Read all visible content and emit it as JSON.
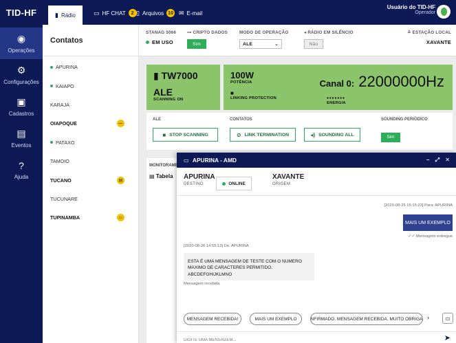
{
  "app": {
    "title": "TID-HF"
  },
  "nav": [
    {
      "label": "Operações",
      "icon": "radio-icon"
    },
    {
      "label": "Configurações",
      "icon": "gear-icon"
    },
    {
      "label": "Cadastros",
      "icon": "document-icon"
    },
    {
      "label": "Eventos",
      "icon": "calendar-icon"
    },
    {
      "label": "Ajuda",
      "icon": "help-icon"
    }
  ],
  "tabs": [
    {
      "label": "Rádio",
      "icon": "radio-icon"
    },
    {
      "label": "HF CHAT",
      "icon": "chat-icon",
      "badge": "2"
    },
    {
      "label": "Arquivos",
      "icon": "file-icon",
      "badge": "10"
    },
    {
      "label": "E-mail",
      "icon": "mail-icon"
    }
  ],
  "user": {
    "name": "Usuário do TID-HF",
    "role": "Operador"
  },
  "contacts": {
    "title": "Contatos",
    "items": [
      {
        "name": "APURINA",
        "online": true,
        "bold": false,
        "badge": ""
      },
      {
        "name": "KAIAPO",
        "online": true,
        "bold": false,
        "badge": ""
      },
      {
        "name": "KARAJA",
        "online": false,
        "bold": false,
        "badge": ""
      },
      {
        "name": "OIAPOQUE",
        "online": false,
        "bold": true,
        "badge": "—"
      },
      {
        "name": "PATAXO",
        "online": true,
        "bold": false,
        "badge": ""
      },
      {
        "name": "TAMOIO",
        "online": false,
        "bold": false,
        "badge": ""
      },
      {
        "name": "TUCANO",
        "online": false,
        "bold": true,
        "badge": "file"
      },
      {
        "name": "TUCUNARE",
        "online": false,
        "bold": false,
        "badge": ""
      },
      {
        "name": "TUPINAMBA",
        "online": false,
        "bold": true,
        "badge": "chat"
      }
    ]
  },
  "status": {
    "stanag_label": "STANAG 5066",
    "stanag_value": "EM USO",
    "cripto_label": "CRIPTO DADOS",
    "cripto_value": "Sim",
    "modo_label": "MODO DE OPERAÇÃO",
    "modo_value": "ALE",
    "silencio_label": "RÁDIO EM SILÊNCIO",
    "silencio_value": "Não",
    "estacao_label": "ESTAÇÃO LOCAL",
    "estacao_value": "XAVANTE"
  },
  "cards": {
    "radio_model": "TW7000",
    "ale_title": "ALE",
    "ale_sub": "SCANNING ON",
    "power_value": "100W",
    "power_label": "POTÊNCIA",
    "linking_label": "LINKING PROTECTION",
    "energy_label": "ENERGIA",
    "channel_label": "Canal 0:",
    "channel_freq": "22000000Hz"
  },
  "controls": {
    "ale_label": "ALE",
    "stop_scanning": "STOP SCANNING",
    "contatos_label": "CONTATOS",
    "link_termination": "LINK TERMINATION",
    "sounding_all": "SOUNDING ALL",
    "sounding_label": "SOUNDING PERIÓDICO",
    "sounding_value": "Sim"
  },
  "monitor": {
    "label": "MONITORAMENTO",
    "tab": "Tabela"
  },
  "chat": {
    "title": "APURINA - AMD",
    "dest_name": "APURINA",
    "dest_label": "DESTINO",
    "status": "ONLINE",
    "origin_name": "XAVANTE",
    "origin_label": "ORIGEM",
    "out_meta": "[2020-08-26 15:15:23] Para: APURINA",
    "out_text": "MAIS UM EXEMPLO",
    "out_status": "Mensagem entregue",
    "in_meta": "[2020-08-26 14:55:13] De: APURINA",
    "in_text": "ESTA É UMA MENSAGEM DE TESTE COM O NUMERO MAXIMO DE CARACTERES PERMITIDO. ABCDEFGHIJKLMNO",
    "in_status": "Mensagem recebida",
    "chips": [
      "MENSAGEM RECEBIDA!",
      "MAIS UM EXEMPLO",
      "CONFIRMADO. MENSAGEM RECEBIDA. MUITO OBRIGADO"
    ],
    "placeholder": "DIGITE UMA MENSAGEM..."
  },
  "colors": {
    "navy": "#0d1a55",
    "green": "#8cc46b",
    "accent_green": "#2fae5a",
    "badge": "#f2c200"
  }
}
